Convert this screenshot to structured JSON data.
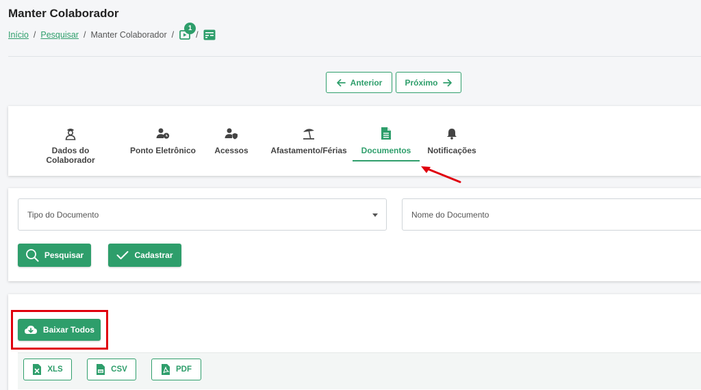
{
  "page": {
    "title": "Manter Colaborador"
  },
  "breadcrumb": {
    "items": [
      "Início",
      "Pesquisar",
      "Manter Colaborador"
    ],
    "separator": "/",
    "video_badge": "1",
    "icons": [
      "video-play-icon",
      "dashboard-icon"
    ]
  },
  "pagination": {
    "previous_label": "Anterior",
    "next_label": "Próximo"
  },
  "tabs": [
    {
      "label": "Dados do Colaborador",
      "icon": "employee-icon"
    },
    {
      "label": "Ponto Eletrônico",
      "icon": "user-clock-icon"
    },
    {
      "label": "Acessos",
      "icon": "user-shield-icon"
    },
    {
      "label": "Afastamento/Férias",
      "icon": "beach-umbrella-icon"
    },
    {
      "label": "Documentos",
      "icon": "document-icon",
      "active": true
    },
    {
      "label": "Notificações",
      "icon": "bell-icon"
    }
  ],
  "filters": {
    "document_type_placeholder": "Tipo do Documento",
    "document_name_placeholder": "Nome do Documento",
    "search_label": "Pesquisar",
    "register_label": "Cadastrar"
  },
  "results": {
    "download_all_label": "Baixar Todos"
  },
  "export": {
    "xls_label": "XLS",
    "csv_label": "CSV",
    "pdf_label": "PDF"
  },
  "colors": {
    "accent": "#2e9e6b",
    "highlight": "#e0000d"
  }
}
